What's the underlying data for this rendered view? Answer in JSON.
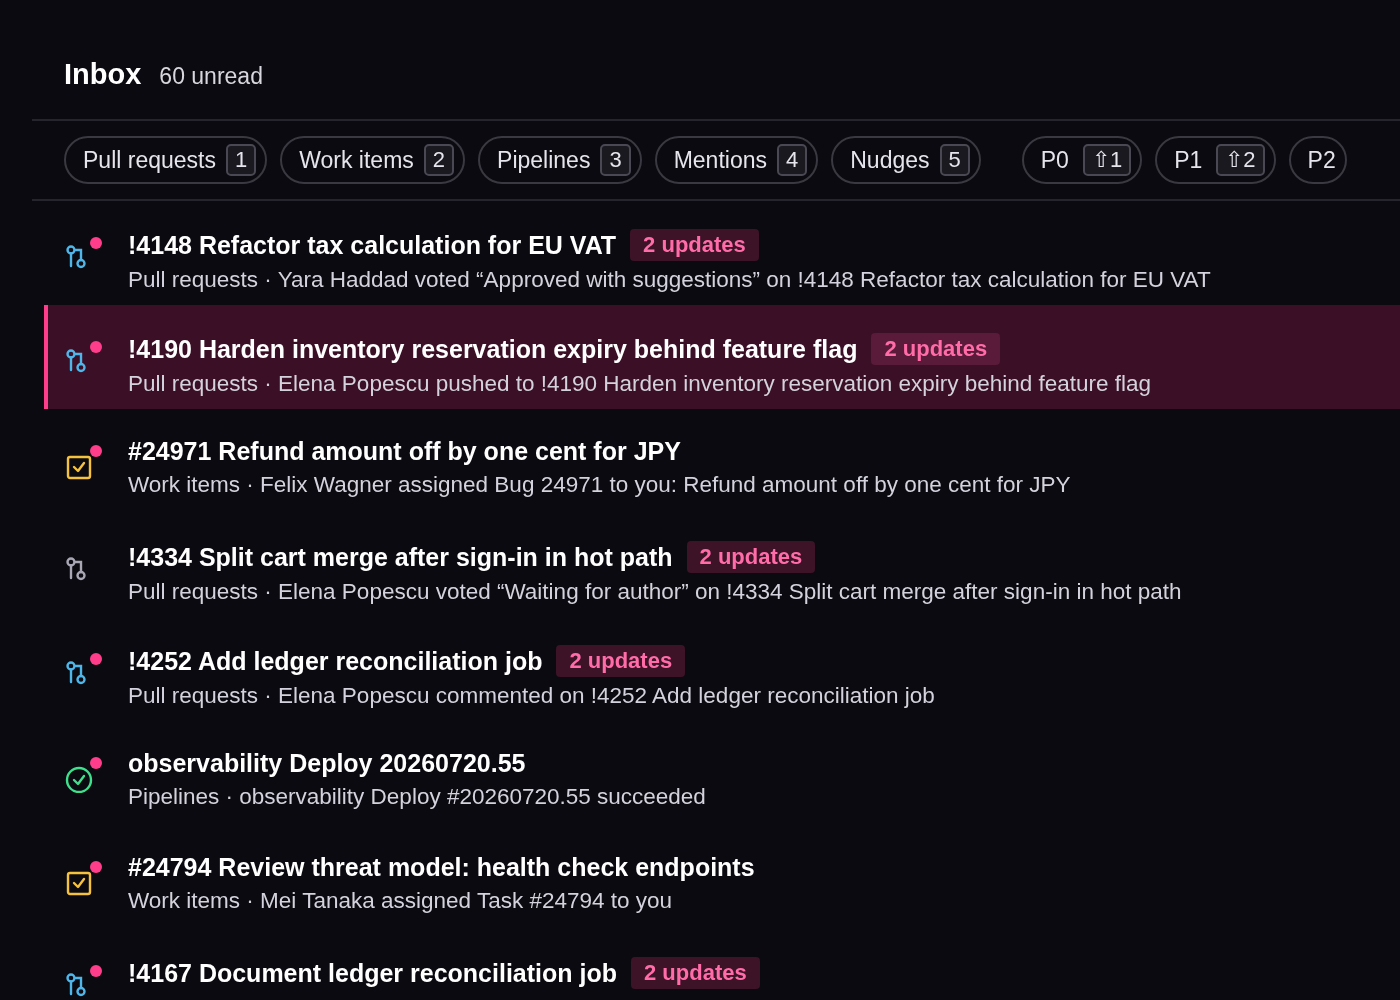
{
  "header": {
    "title": "Inbox",
    "unread": "60 unread"
  },
  "filters": [
    {
      "kind": "type",
      "label": "Pull requests",
      "count": "1"
    },
    {
      "kind": "type",
      "label": "Work items",
      "count": "2"
    },
    {
      "kind": "type",
      "label": "Pipelines",
      "count": "3"
    },
    {
      "kind": "type",
      "label": "Mentions",
      "count": "4"
    },
    {
      "kind": "type",
      "label": "Nudges",
      "count": "5"
    },
    {
      "kind": "priority",
      "label": "P0",
      "count": "⇧1"
    },
    {
      "kind": "priority",
      "label": "P1",
      "count": "⇧2"
    },
    {
      "kind": "priority",
      "label": "P2"
    }
  ],
  "items": [
    {
      "kind": "pull-request",
      "unread": true,
      "selected": false,
      "title": "!4148 Refactor tax calculation for EU VAT",
      "badge": "2 updates",
      "subtitle": "Pull requests · Yara Haddad voted “Approved with suggestions” on !4148 Refactor tax calculation for EU VAT"
    },
    {
      "kind": "pull-request",
      "unread": true,
      "selected": true,
      "title": "!4190 Harden inventory reservation expiry behind feature flag",
      "badge": "2 updates",
      "subtitle": "Pull requests · Elena Popescu pushed to !4190 Harden inventory reservation expiry behind feature flag"
    },
    {
      "kind": "work-item",
      "unread": true,
      "selected": false,
      "title": "#24971 Refund amount off by one cent for JPY",
      "subtitle": "Work items · Felix Wagner assigned Bug 24971 to you: Refund amount off by one cent for JPY"
    },
    {
      "kind": "pull-request",
      "unread": false,
      "selected": false,
      "title": "!4334 Split cart merge after sign-in in hot path",
      "badge": "2 updates",
      "subtitle": "Pull requests · Elena Popescu voted “Waiting for author” on !4334 Split cart merge after sign-in in hot path"
    },
    {
      "kind": "pull-request",
      "unread": true,
      "selected": false,
      "title": "!4252 Add ledger reconciliation job",
      "badge": "2 updates",
      "subtitle": "Pull requests · Elena Popescu commented on !4252 Add ledger reconciliation job"
    },
    {
      "kind": "pipeline",
      "unread": true,
      "selected": false,
      "title": "observability Deploy 20260720.55",
      "subtitle": "Pipelines · observability Deploy #20260720.55 succeeded"
    },
    {
      "kind": "work-item",
      "unread": true,
      "selected": false,
      "title": "#24794 Review threat model: health check endpoints",
      "subtitle": "Work items · Mei Tanaka assigned Task #24794 to you"
    },
    {
      "kind": "pull-request",
      "unread": true,
      "selected": false,
      "title": "!4167 Document ledger reconciliation job",
      "badge": "2 updates"
    }
  ]
}
